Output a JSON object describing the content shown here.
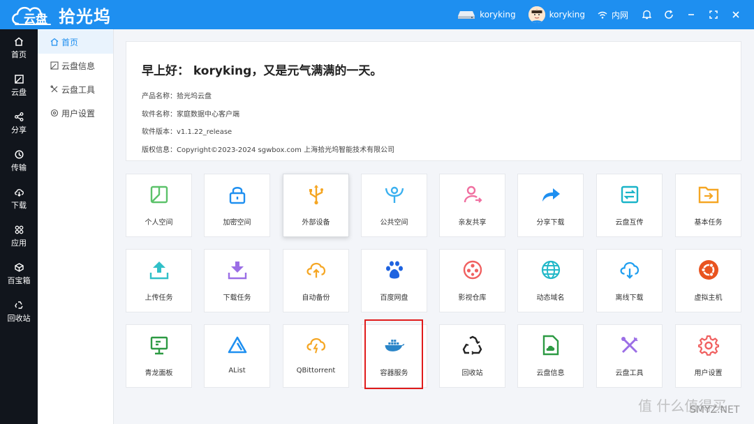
{
  "header": {
    "logo_cloud_text": "云盘",
    "app_title": "拾光坞",
    "device_name": "koryking",
    "user_name": "koryking",
    "network": "内网"
  },
  "rail": [
    {
      "label": "首页",
      "icon": "home-icon"
    },
    {
      "label": "云盘",
      "icon": "disk-icon"
    },
    {
      "label": "分享",
      "icon": "share-icon"
    },
    {
      "label": "传输",
      "icon": "transfer-icon"
    },
    {
      "label": "下载",
      "icon": "download-icon"
    },
    {
      "label": "应用",
      "icon": "apps-icon"
    },
    {
      "label": "百宝箱",
      "icon": "toolbox-icon"
    },
    {
      "label": "回收站",
      "icon": "recycle-icon"
    }
  ],
  "subnav": [
    {
      "label": "首页",
      "icon": "home-icon",
      "active": true
    },
    {
      "label": "云盘信息",
      "icon": "disk-icon",
      "active": false
    },
    {
      "label": "云盘工具",
      "icon": "tools-icon",
      "active": false
    },
    {
      "label": "用户设置",
      "icon": "gear-icon",
      "active": false
    }
  ],
  "welcome": {
    "greeting": "早上好： koryking，又是元气满满的一天。",
    "product": "产品名称：拾光坞云盘",
    "software": "软件名称：家庭数据中心客户端",
    "version": "软件版本：v1.1.22_release",
    "copyright": "版权信息：Copyright©2023-2024 sgwbox.com 上海拾光坞智能技术有限公司"
  },
  "tiles": [
    {
      "label": "个人空间",
      "icon": "personal-space-icon",
      "color": "#5cc26a"
    },
    {
      "label": "加密空间",
      "icon": "lock-icon",
      "color": "#1e8ff0"
    },
    {
      "label": "外部设备",
      "icon": "usb-icon",
      "color": "#f5a623"
    },
    {
      "label": "公共空间",
      "icon": "public-space-icon",
      "color": "#3ab0ef"
    },
    {
      "label": "亲友共享",
      "icon": "friend-share-icon",
      "color": "#f06fa0"
    },
    {
      "label": "分享下载",
      "icon": "share-download-icon",
      "color": "#1e8ff0"
    },
    {
      "label": "云盘互传",
      "icon": "transfer-icon",
      "color": "#1ab4c8"
    },
    {
      "label": "基本任务",
      "icon": "folder-task-icon",
      "color": "#f5a623"
    },
    {
      "label": "上传任务",
      "icon": "upload-icon",
      "color": "#30c0c8"
    },
    {
      "label": "下载任务",
      "icon": "download-task-icon",
      "color": "#9b6ee6"
    },
    {
      "label": "自动备份",
      "icon": "cloud-backup-icon",
      "color": "#f5a623"
    },
    {
      "label": "百度网盘",
      "icon": "baidu-icon",
      "color": "#1e63e0"
    },
    {
      "label": "影视仓库",
      "icon": "film-icon",
      "color": "#f06060"
    },
    {
      "label": "动态域名",
      "icon": "globe-icon",
      "color": "#22b8c8"
    },
    {
      "label": "离线下载",
      "icon": "offline-download-icon",
      "color": "#1e9ef0"
    },
    {
      "label": "虚拟主机",
      "icon": "ubuntu-icon",
      "color": "#e95420"
    },
    {
      "label": "青龙面板",
      "icon": "panel-icon",
      "color": "#2d9a43"
    },
    {
      "label": "AList",
      "icon": "alist-icon",
      "color": "#1e8ff0"
    },
    {
      "label": "QBittorrent",
      "icon": "qbittorrent-icon",
      "color": "#f5a623"
    },
    {
      "label": "容器服务",
      "icon": "docker-icon",
      "color": "#2a85c8"
    },
    {
      "label": "回收站",
      "icon": "recycle-icon",
      "color": "#222222"
    },
    {
      "label": "云盘信息",
      "icon": "disk-info-icon",
      "color": "#2d9a43"
    },
    {
      "label": "云盘工具",
      "icon": "tools-icon",
      "color": "#9b6ee6"
    },
    {
      "label": "用户设置",
      "icon": "gear-icon",
      "color": "#f06060"
    }
  ],
  "watermark": {
    "text": "值 什么值得买",
    "text2": "SMYZ.NET"
  }
}
